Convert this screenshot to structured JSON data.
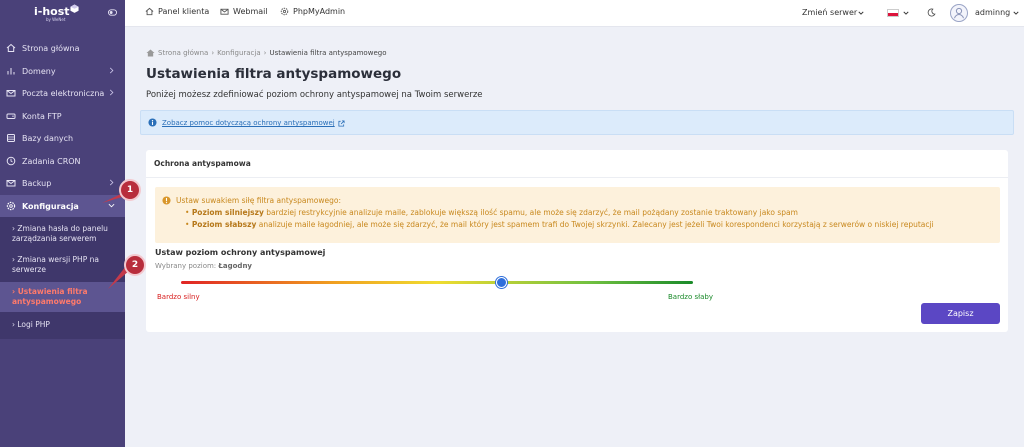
{
  "sidebar": {
    "logo": "i-host",
    "logo_sub": "by WeNet",
    "items": [
      {
        "label": "Strona główna",
        "icon": "home-icon"
      },
      {
        "label": "Domeny",
        "icon": "chart-icon"
      },
      {
        "label": "Poczta elektroniczna",
        "icon": "mail-icon"
      },
      {
        "label": "Konta FTP",
        "icon": "drive-icon"
      },
      {
        "label": "Bazy danych",
        "icon": "database-icon"
      },
      {
        "label": "Zadania CRON",
        "icon": "clock-icon"
      },
      {
        "label": "Backup",
        "icon": "backup-icon"
      },
      {
        "label": "Konfiguracja",
        "icon": "gear-icon"
      }
    ],
    "sub_items": [
      "› Zmiana hasła do panelu zarządzania serwerem",
      "› Zmiana wersji PHP na serwerze",
      "› Ustawienia filtra antyspamowego",
      "› Logi PHP"
    ]
  },
  "topbar": {
    "links": [
      "Panel klienta",
      "Webmail",
      "PhpMyAdmin"
    ],
    "server_select": "Zmień serwer",
    "username": "adminng"
  },
  "breadcrumb": {
    "home": "Strona główna",
    "config": "Konfiguracja",
    "current": "Ustawienia filtra antyspamowego"
  },
  "page": {
    "title": "Ustawienia filtra antyspamowego",
    "description": "Poniżej możesz zdefiniować poziom ochrony antyspamowej na Twoim serwerze",
    "help_link": "Zobacz pomoc dotyczącą ochrony antyspamowej"
  },
  "card": {
    "title": "Ochrona antyspamowa",
    "warn_intro": "Ustaw suwakiem siłę filtra antyspamowego:",
    "warn_strong_bold": "Poziom silniejszy",
    "warn_strong_text": " bardziej restrykcyjnie analizuje maile, zablokuje większą ilość spamu, ale może się zdarzyć, że mail pożądany zostanie traktowany jako spam",
    "warn_weak_bold": "Poziom słabszy",
    "warn_weak_text": " analizuje maile łagodniej, ale może się zdarzyć, że mail który jest spamem trafi do Twojej skrzynki. Zalecany jest jeżeli Twoi korespondenci korzystają z serwerów o niskiej reputacji",
    "slider_title": "Ustaw poziom ochrony antyspamowej",
    "slider_selected_label": "Wybrany poziom: ",
    "slider_selected_value": "Łagodny",
    "slider_value": 0.625,
    "slider_left": "Bardzo silny",
    "slider_right": "Bardzo słaby",
    "save": "Zapisz"
  },
  "annotations": {
    "badge1": "1",
    "badge2": "2"
  },
  "colors": {
    "sidebar": "#4a4179",
    "accent": "#5b47c4",
    "warn_bg": "#fdf1dc",
    "warn_text": "#c8881e",
    "info_bg": "#dcebfb",
    "badge": "#b82d3c",
    "active_sub": "#ff7a6b"
  }
}
